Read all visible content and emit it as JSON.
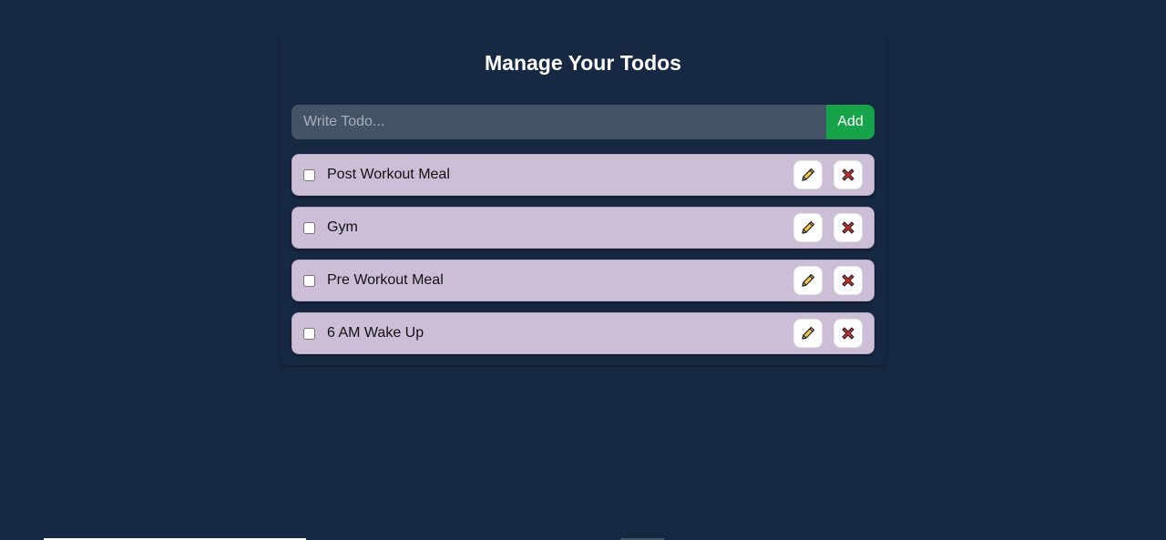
{
  "app": {
    "title": "Manage Your Todos"
  },
  "form": {
    "placeholder": "Write Todo...",
    "value": "",
    "add_label": "Add"
  },
  "todos": [
    {
      "text": "Post Workout Meal",
      "completed": false
    },
    {
      "text": "Gym",
      "completed": false
    },
    {
      "text": "Pre Workout Meal",
      "completed": false
    },
    {
      "text": "6 AM Wake Up",
      "completed": false
    }
  ],
  "icons": {
    "edit": "pencil-icon",
    "delete": "cross-mark-icon"
  },
  "colors": {
    "background": "#172842",
    "todo_item": "#ccbed7",
    "add_button": "#16a34a",
    "delete_icon": "#d32f2f",
    "edit_icon": "#f7c948"
  }
}
